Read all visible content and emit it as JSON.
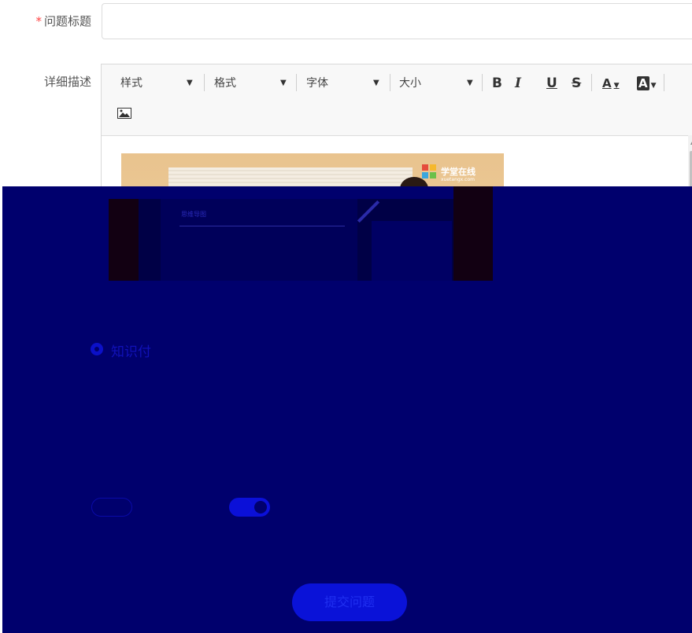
{
  "form": {
    "title_label": "问题标题",
    "required_mark": "*",
    "title_value": "",
    "desc_label": "详细描述"
  },
  "editor": {
    "toolbar": {
      "style_label": "样式",
      "format_label": "格式",
      "font_label": "字体",
      "size_label": "大小",
      "bold": "B",
      "italic": "I",
      "underline": "U",
      "strike": "S",
      "text_color": "A",
      "bg_color": "A"
    },
    "image": {
      "brand": "学堂在线",
      "brand_sub": "xuetangx.com",
      "screen_title": "思维导图"
    }
  },
  "options": {
    "radio_label": "知识付",
    "radio_selected": true,
    "toggle_left_on": false,
    "toggle_right_on": true
  },
  "actions": {
    "submit_label": "提交问题"
  },
  "colors": {
    "overlay": "#00006d",
    "accent": "#0b10d8",
    "required": "#ff4444"
  }
}
